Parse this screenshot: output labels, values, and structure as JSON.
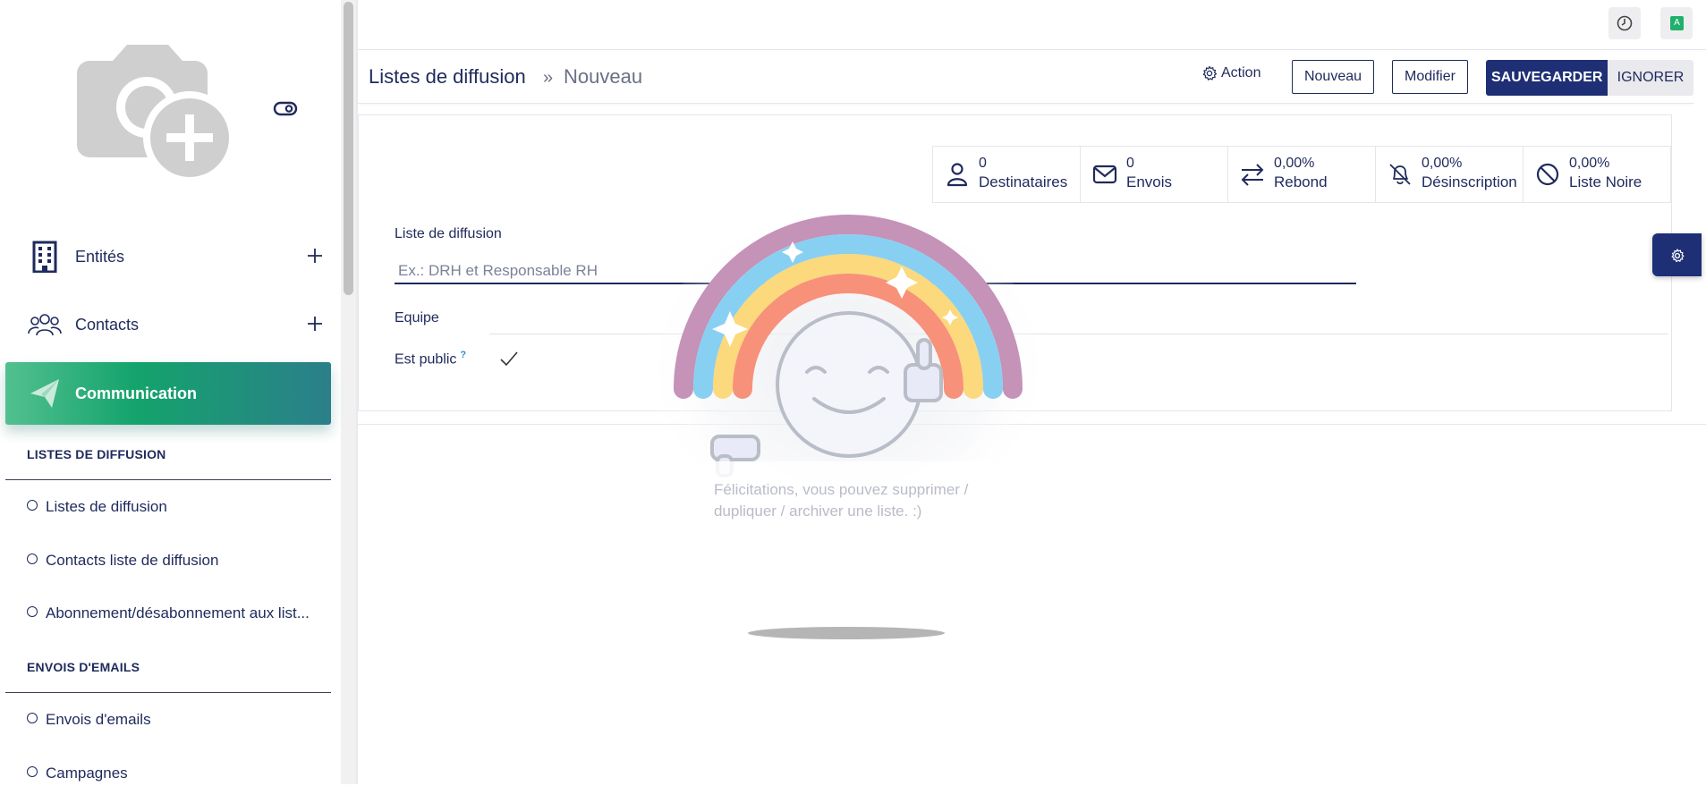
{
  "sidebar": {
    "nav": [
      {
        "label": "Entités",
        "icon": "building-icon"
      },
      {
        "label": "Contacts",
        "icon": "people-icon"
      },
      {
        "label": "Communication",
        "icon": "paper-plane-icon",
        "active": true
      }
    ],
    "sections": [
      {
        "title": "LISTES DE DIFFUSION",
        "items": [
          "Listes de diffusion",
          "Contacts liste de diffusion",
          "Abonnement/désabonnement aux list..."
        ]
      },
      {
        "title": "ENVOIS D'EMAILS",
        "items": [
          "Envois d'emails",
          "Campagnes"
        ]
      }
    ]
  },
  "topbar": {
    "avatar_letter": "A"
  },
  "breadcrumb": {
    "parent": "Listes de diffusion",
    "separator": "»",
    "current": "Nouveau"
  },
  "toolbar": {
    "action_label": "Action",
    "new_label": "Nouveau",
    "edit_label": "Modifier",
    "save_label": "SAUVEGARDER",
    "discard_label": "IGNORER"
  },
  "stats": [
    {
      "value": "0",
      "label": "Destinataires",
      "icon": "user-icon"
    },
    {
      "value": "0",
      "label": "Envois",
      "icon": "envelope-icon"
    },
    {
      "value": "0,00%",
      "label": "Rebond",
      "icon": "swap-arrows-icon"
    },
    {
      "value": "0,00%",
      "label": "Désinscription",
      "icon": "bell-off-icon"
    },
    {
      "value": "0,00%",
      "label": "Liste Noire",
      "icon": "ban-icon"
    }
  ],
  "form": {
    "list_label": "Liste de diffusion",
    "list_placeholder": "Ex.: DRH et Responsable RH",
    "team_label": "Equipe",
    "public_label": "Est public",
    "public_help": "?",
    "public_checked": true
  },
  "rainbow": {
    "message": "Félicitations, vous pouvez supprimer / dupliquer / archiver une liste. :)"
  },
  "colors": {
    "primary": "#1e2f75",
    "accent_green": "#14a36c",
    "text": "#1f2a5c"
  }
}
